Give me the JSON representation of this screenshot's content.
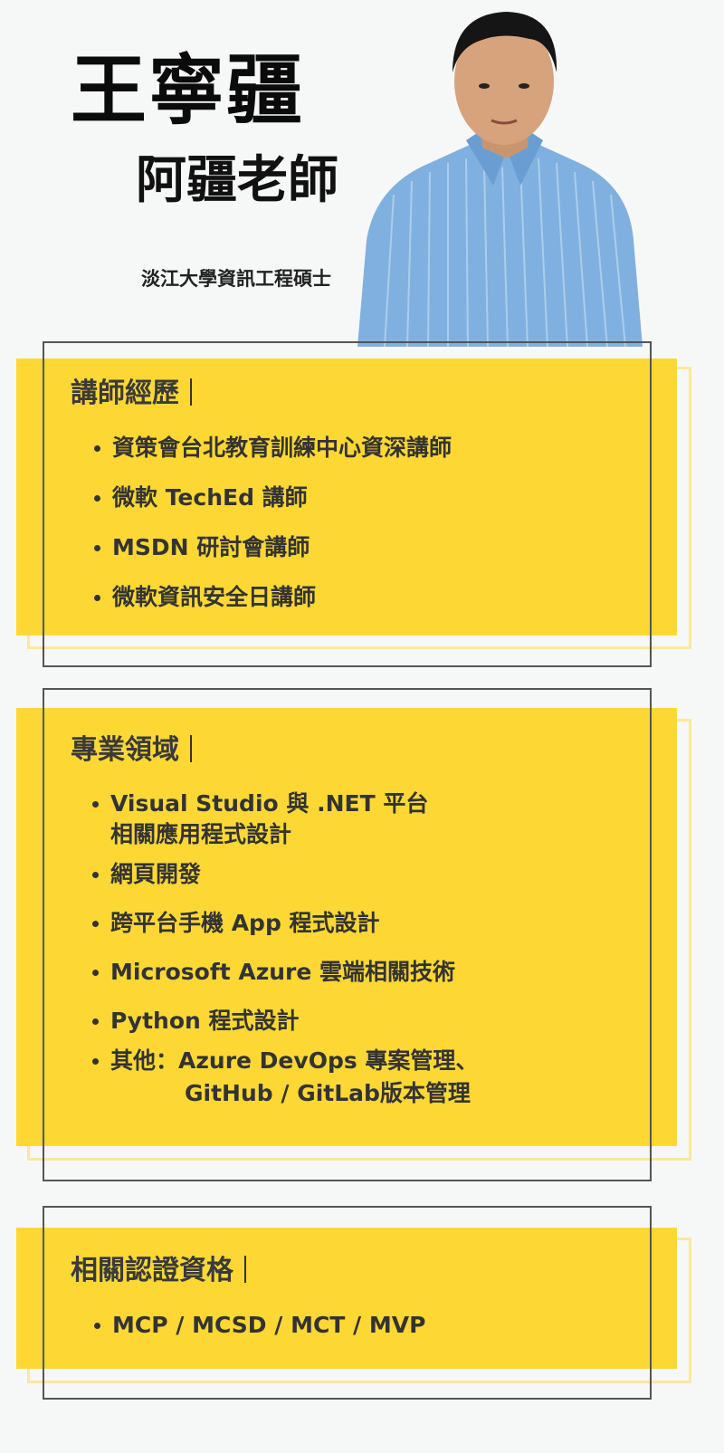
{
  "header": {
    "name": "王寧疆",
    "nickname": "阿疆老師",
    "degree": "淡江大學資訊工程碩士"
  },
  "icons": {
    "portrait": "person-portrait-icon"
  },
  "colors": {
    "background": "#f6f8f7",
    "accent_yellow": "#fdd835",
    "frame": "#555555",
    "shirt_blue": "#7fb0df"
  },
  "sections": {
    "experience": {
      "title": "講師經歷",
      "items": [
        "資策會台北教育訓練中心資深講師",
        "微軟 TechEd 講師",
        "MSDN 研討會講師",
        "微軟資訊安全日講師"
      ]
    },
    "expertise": {
      "title": "專業領域",
      "items": [
        {
          "line1": "Visual Studio 與 .NET 平台",
          "line2": "相關應用程式設計"
        },
        {
          "line1": "網頁開發"
        },
        {
          "line1": "跨平台手機 App 程式設計"
        },
        {
          "line1": "Microsoft Azure 雲端相關技術"
        },
        {
          "line1": "Python 程式設計"
        },
        {
          "line1": "其他：Azure DevOps 專案管理、",
          "line2": "GitHub / GitLab版本管理"
        }
      ]
    },
    "certifications": {
      "title": "相關認證資格",
      "items": [
        "MCP / MCSD / MCT / MVP"
      ]
    }
  }
}
